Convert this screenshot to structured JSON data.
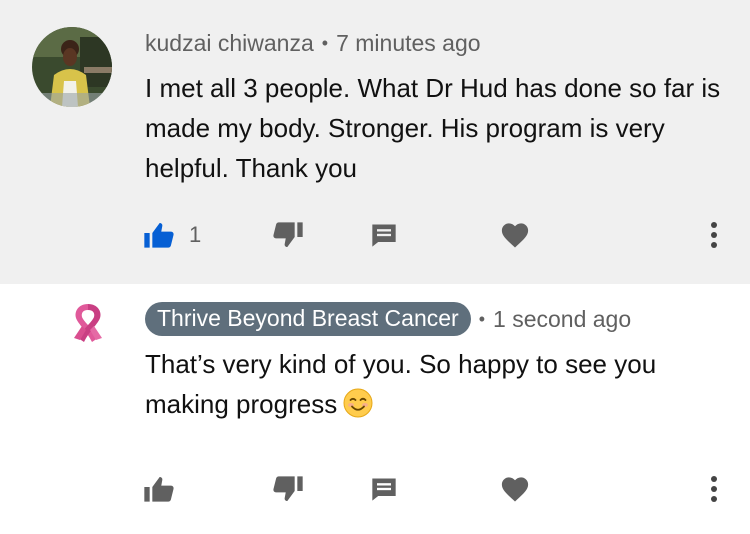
{
  "comments": [
    {
      "author": "kudzai chiwanza",
      "separator": "•",
      "time": "7 minutes ago",
      "text": "I met all 3 people. What Dr Hud has done so far is made my body. Stronger. His program is very helpful. Thank you",
      "like_count": "1",
      "liked": true,
      "icons": [
        "thumb-up-icon",
        "thumb-down-icon",
        "reply-icon",
        "heart-icon",
        "more-vert-icon"
      ]
    },
    {
      "author": "Thrive Beyond Breast Cancer",
      "separator": "•",
      "time": "1 second ago",
      "text": "That’s very kind of you. So happy to see you making progress",
      "emoji": "😊",
      "icons": [
        "thumb-up-icon",
        "thumb-down-icon",
        "reply-icon",
        "heart-icon",
        "more-vert-icon"
      ]
    }
  ],
  "colors": {
    "liked_blue": "#065fd4",
    "icon_gray": "#606060",
    "chip_bg": "#5f6f7c",
    "ribbon_pink": "#d94e8f"
  }
}
